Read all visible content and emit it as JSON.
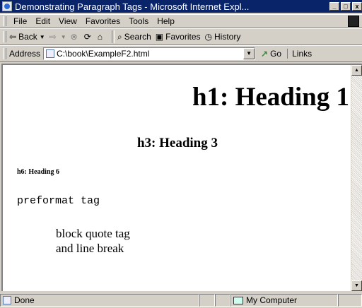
{
  "window": {
    "title": "Demonstrating Paragraph Tags - Microsoft Internet Expl...",
    "min_glyph": "_",
    "max_glyph": "□",
    "close_glyph": "x"
  },
  "menu": {
    "items": [
      "File",
      "Edit",
      "View",
      "Favorites",
      "Tools",
      "Help"
    ]
  },
  "toolbar": {
    "back_label": "Back",
    "search_label": "Search",
    "favorites_label": "Favorites",
    "history_label": "History"
  },
  "address": {
    "label": "Address",
    "value": "C:\\book\\ExampleF2.html",
    "go_label": "Go",
    "links_label": "Links"
  },
  "page": {
    "h1": "h1: Heading 1",
    "h3": "h3: Heading 3",
    "h6": "h6: Heading 6",
    "pre": "preformat tag",
    "bq_line1": "block quote tag",
    "bq_line2": "and line break"
  },
  "status": {
    "text": "Done",
    "zone": "My Computer"
  },
  "icons": {
    "back": "back-arrow-icon",
    "forward": "forward-arrow-icon",
    "stop": "stop-icon",
    "refresh": "refresh-icon",
    "home": "home-icon",
    "search": "search-icon",
    "favorites": "favorites-icon",
    "history": "history-icon"
  },
  "colors": {
    "titlebar": "#0a246a",
    "chrome": "#d4d0c8"
  }
}
